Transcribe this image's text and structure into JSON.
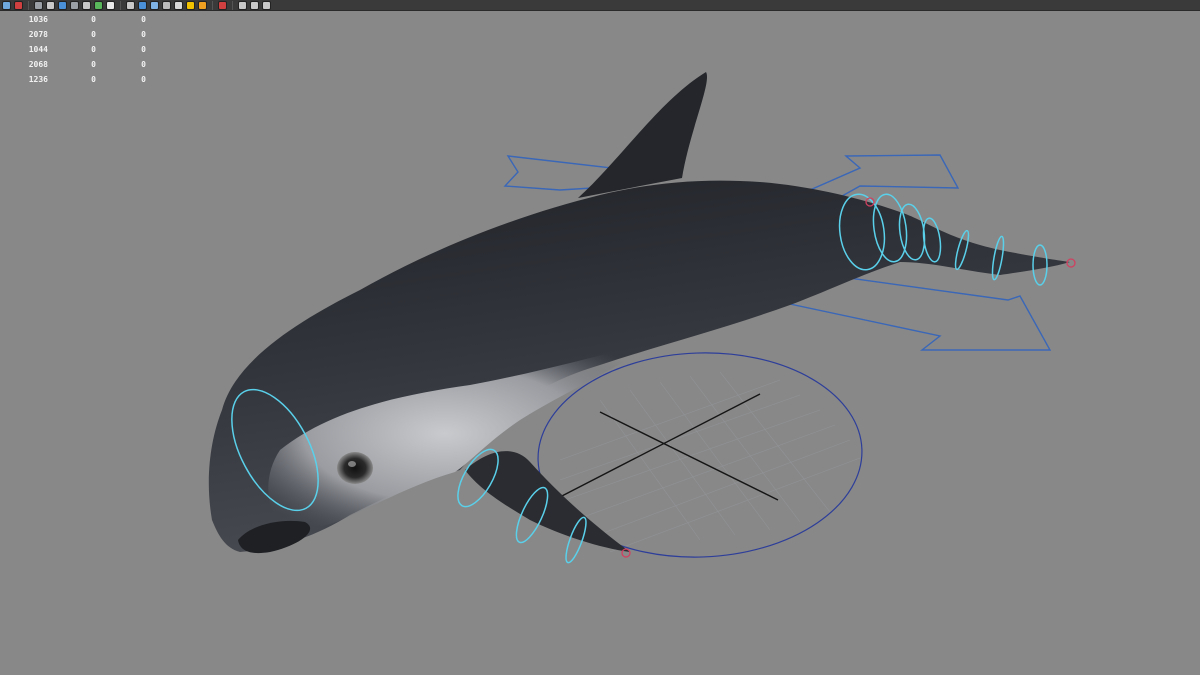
{
  "toolbar": {
    "icons": [
      {
        "name": "select-tool-icon",
        "color": "#6fa8dc"
      },
      {
        "name": "lasso-tool-icon",
        "color": "#d04040"
      },
      {
        "name": "sep"
      },
      {
        "name": "wireframe-icon",
        "color": "#9aa0a6"
      },
      {
        "name": "grid-icon",
        "color": "#c9c9c9"
      },
      {
        "name": "smooth-shade-icon",
        "color": "#4a90d9"
      },
      {
        "name": "shade-selected-icon",
        "color": "#9aa0a6"
      },
      {
        "name": "camera-icon",
        "color": "#c9c9c9"
      },
      {
        "name": "xray-icon",
        "color": "#5ab65a"
      },
      {
        "name": "text-icon",
        "color": "#e8e8e8"
      },
      {
        "name": "sep"
      },
      {
        "name": "cube-wire-icon",
        "color": "#c9c9c9"
      },
      {
        "name": "cube-shaded-icon",
        "color": "#4a90d9"
      },
      {
        "name": "cube-textured-icon",
        "color": "#7fb2e5"
      },
      {
        "name": "checker-icon",
        "color": "#bbbbbb"
      },
      {
        "name": "sphere-icon",
        "color": "#d9d9d9"
      },
      {
        "name": "light-icon",
        "color": "#f2c200"
      },
      {
        "name": "shadow-light-icon",
        "color": "#f0a020"
      },
      {
        "name": "sep"
      },
      {
        "name": "magnet-icon",
        "color": "#d04040"
      },
      {
        "name": "sep"
      },
      {
        "name": "isolate-icon",
        "color": "#c9c9c9"
      },
      {
        "name": "cage-icon",
        "color": "#c9c9c9"
      },
      {
        "name": "share-icon",
        "color": "#c9c9c9"
      }
    ]
  },
  "hud_stats": {
    "rows": [
      [
        "1036",
        "0",
        "0"
      ],
      [
        "2078",
        "0",
        "0"
      ],
      [
        "1044",
        "0",
        "0"
      ],
      [
        "2068",
        "0",
        "0"
      ],
      [
        "1236",
        "0",
        "0"
      ]
    ]
  },
  "colors": {
    "viewport_bg": "#888888",
    "rig_curve": "#3a67b8",
    "joint_ring": "#5ad0ea",
    "body_dark": "#2b2d33",
    "body_light": "#b5b8bd"
  }
}
